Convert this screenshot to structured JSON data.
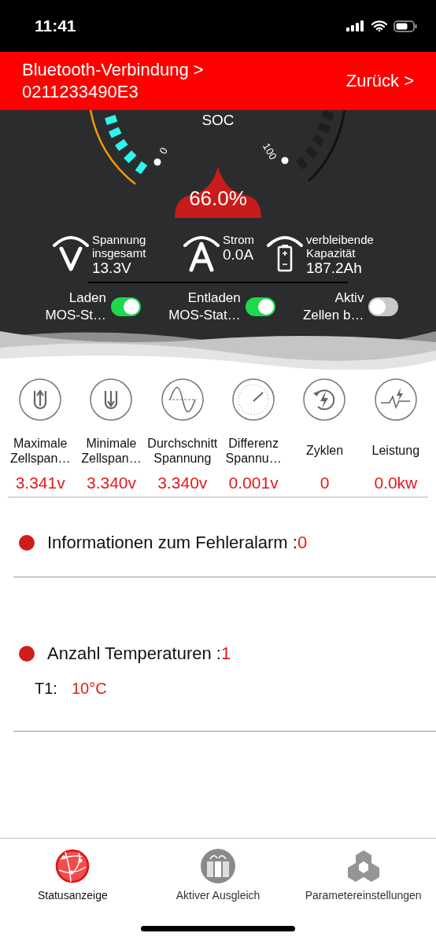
{
  "status_bar": {
    "time": "11:41"
  },
  "header": {
    "title": "Bluetooth-Verbindung >",
    "device": "0211233490E3",
    "back": "Zurück >"
  },
  "gauge": {
    "label": "SOC",
    "min": "0",
    "max": "100",
    "value": "66.0%"
  },
  "readings": [
    {
      "kind": "volt",
      "label": "Spannung insgesamt",
      "value": "13.3V"
    },
    {
      "kind": "amp",
      "label": "Strom",
      "value": "0.0A"
    },
    {
      "kind": "battery",
      "label": "verbleibende Kapazität",
      "value": "187.2Ah"
    }
  ],
  "switches": [
    {
      "label": "Laden",
      "sublabel": "MOS-St…",
      "on": true
    },
    {
      "label": "Entladen",
      "sublabel": "MOS-Stat…",
      "on": true
    },
    {
      "label": "Aktiv",
      "sublabel": "Zellen b…",
      "on": false
    }
  ],
  "stats": [
    {
      "kind": "max",
      "label": "Maximale Zellspan…",
      "value": "3.341v"
    },
    {
      "kind": "min",
      "label": "Minimale Zellspan…",
      "value": "3.340v"
    },
    {
      "kind": "avg",
      "label": "Durchschnitt Spannung",
      "value": "3.340v"
    },
    {
      "kind": "diff",
      "label": "Differenz Spannu…",
      "value": "0.001v"
    },
    {
      "kind": "cycles",
      "label": "Zyklen",
      "value": "0"
    },
    {
      "kind": "power",
      "label": "Leistung",
      "value": "0.0kw"
    }
  ],
  "fault": {
    "label": "Informationen zum Fehleralarm :",
    "count": "0"
  },
  "temperature": {
    "label": "Anzahl Temperaturen :",
    "count": "1",
    "sensors": [
      {
        "name": "T1:",
        "value": "10°C"
      }
    ]
  },
  "tabs": [
    {
      "kind": "status",
      "label": "Statusanzeige",
      "selected": true
    },
    {
      "kind": "balance",
      "label": "Aktiver Ausgleich",
      "selected": false
    },
    {
      "kind": "settings",
      "label": "Parametereinstellungen",
      "selected": false
    }
  ]
}
